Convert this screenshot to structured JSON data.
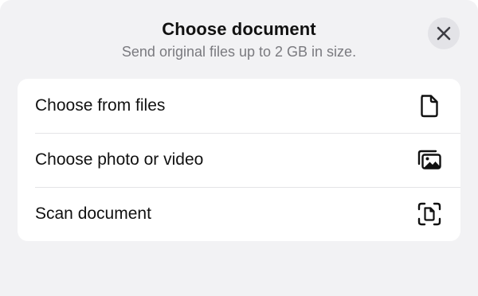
{
  "header": {
    "title": "Choose document",
    "subtitle": "Send original files up to 2 GB in size.",
    "close_icon": "close-icon"
  },
  "options": [
    {
      "label": "Choose from files",
      "icon": "document-icon"
    },
    {
      "label": "Choose photo or video",
      "icon": "photos-icon"
    },
    {
      "label": "Scan document",
      "icon": "scan-document-icon"
    }
  ],
  "colors": {
    "sheet_background": "#f2f2f4",
    "list_background": "#ffffff",
    "title_text": "#111111",
    "subtitle_text": "#7a7a7f",
    "close_button_background": "#e3e3e7",
    "separator": "#e4e4e7"
  }
}
